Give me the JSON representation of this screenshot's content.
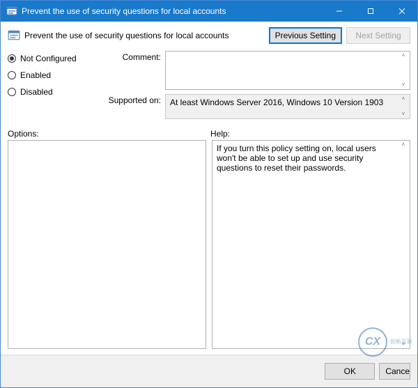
{
  "titlebar": {
    "title": "Prevent the use of security questions for local accounts"
  },
  "header": {
    "policy_title": "Prevent the use of security questions for local accounts",
    "prev_btn": "Previous Setting",
    "next_btn": "Next Setting"
  },
  "state": {
    "options": [
      "Not Configured",
      "Enabled",
      "Disabled"
    ],
    "selected_index": 0
  },
  "fields": {
    "comment_label": "Comment:",
    "comment_value": "",
    "supported_label": "Supported on:",
    "supported_value": "At least Windows Server 2016, Windows 10 Version 1903"
  },
  "lower": {
    "options_label": "Options:",
    "help_label": "Help:",
    "options_text": "",
    "help_text": "If you turn this policy setting on, local users won't be able to set up and use security questions to reset their passwords."
  },
  "footer": {
    "ok": "OK",
    "cancel": "Cance"
  },
  "watermark": {
    "mark": "CX",
    "text": "创新互联"
  }
}
